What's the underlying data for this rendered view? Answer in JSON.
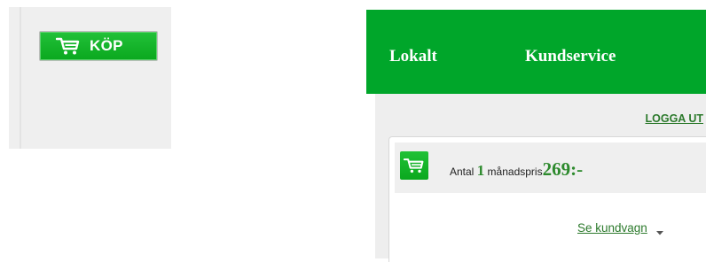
{
  "left_panel": {
    "buy_button": {
      "label": "KÖP",
      "icon": "cart-icon"
    }
  },
  "right_panel": {
    "nav": {
      "items": [
        {
          "label": "Lokalt"
        },
        {
          "label": "Kundservice"
        }
      ]
    },
    "account": {
      "logout_label": "LOGGA UT"
    },
    "cart": {
      "icon": "cart-icon",
      "antal_label": "Antal",
      "quantity": "1",
      "monthly_label": "månadspris",
      "price": "269:-",
      "view_cart_label": "Se kundvagn",
      "dropdown_icon": "chevron-down-icon"
    }
  },
  "colors": {
    "brand_green": "#00a62a",
    "button_green": "#17b52c",
    "link_green": "#2c7a2c",
    "panel_gray": "#efefef"
  }
}
